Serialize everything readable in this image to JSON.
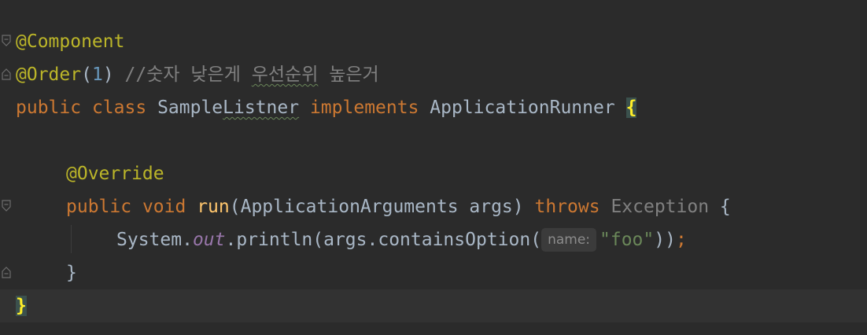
{
  "editor": {
    "lines": {
      "l1": {
        "annotation": "@Component"
      },
      "l2": {
        "annotation": "@Order",
        "open_paren": "(",
        "number": "1",
        "close_paren": ")",
        "comment_prefix": " //숫자 낮은게 ",
        "comment_typo": "우선순위",
        "comment_suffix": " 높은거"
      },
      "l3": {
        "kw_public": "public",
        "kw_class": "class",
        "class_name_start": "Sample",
        "class_name_typo": "Listner",
        "kw_implements": "implements",
        "interface_name": "ApplicationRunner",
        "open_brace": "{"
      },
      "l5": {
        "annotation": "@Override"
      },
      "l6": {
        "kw_public": "public",
        "kw_void": "void",
        "method_name": "run",
        "params": "(ApplicationArguments args)",
        "kw_throws": "throws",
        "exception": "Exception",
        "open_brace": "{"
      },
      "l7": {
        "system": "System.",
        "out": "out",
        "println_call": ".println(args.containsOption(",
        "param_hint": "name:",
        "string_literal": "\"foo\"",
        "close_parens": "))",
        "semicolon": ";"
      },
      "l8": {
        "close_brace": "}"
      },
      "l9": {
        "close_brace": "}"
      }
    }
  },
  "colors": {
    "background": "#2b2b2b",
    "current_line": "#323232",
    "annotation": "#bbb529",
    "keyword": "#cc7832",
    "method": "#ffc66d",
    "string": "#6a8759",
    "number": "#6897bb",
    "comment": "#808080",
    "static_field": "#9876aa",
    "brace_match_bg": "#3b514d",
    "brace_match_fg": "#ffef28"
  }
}
